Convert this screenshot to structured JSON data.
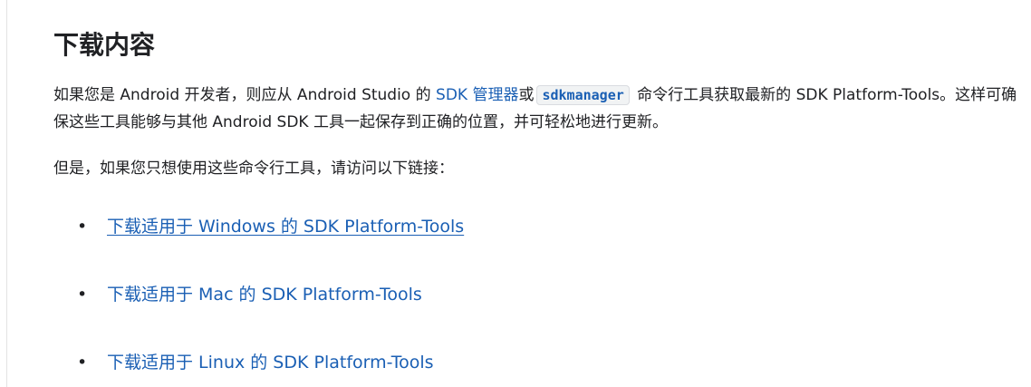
{
  "section": {
    "title": "下载内容",
    "intro": {
      "text_before_link": "如果您是 Android 开发者，则应从 Android Studio 的 ",
      "sdk_manager_link": "SDK 管理器",
      "text_or": "或",
      "sdkmanager_code": "sdkmanager",
      "text_after_code": " 命令行工具获取最新的 SDK Platform-Tools。这样可确保这些工具能够与其他 Android SDK 工具一起保存到正确的位置，并可轻松地进行更新。"
    },
    "but_paragraph": "但是，如果您只想使用这些命令行工具，请访问以下链接：",
    "downloads": [
      {
        "label": "下载适用于 Windows 的 SDK Platform-Tools",
        "underlined": true
      },
      {
        "label": "下载适用于 Mac 的 SDK Platform-Tools",
        "underlined": false
      },
      {
        "label": "下载适用于 Linux 的 SDK Platform-Tools",
        "underlined": false
      }
    ],
    "bullet_glyph": "•"
  },
  "colors": {
    "text": "#202124",
    "link": "#1a5fb4",
    "code_bg": "#f1f3f4"
  }
}
